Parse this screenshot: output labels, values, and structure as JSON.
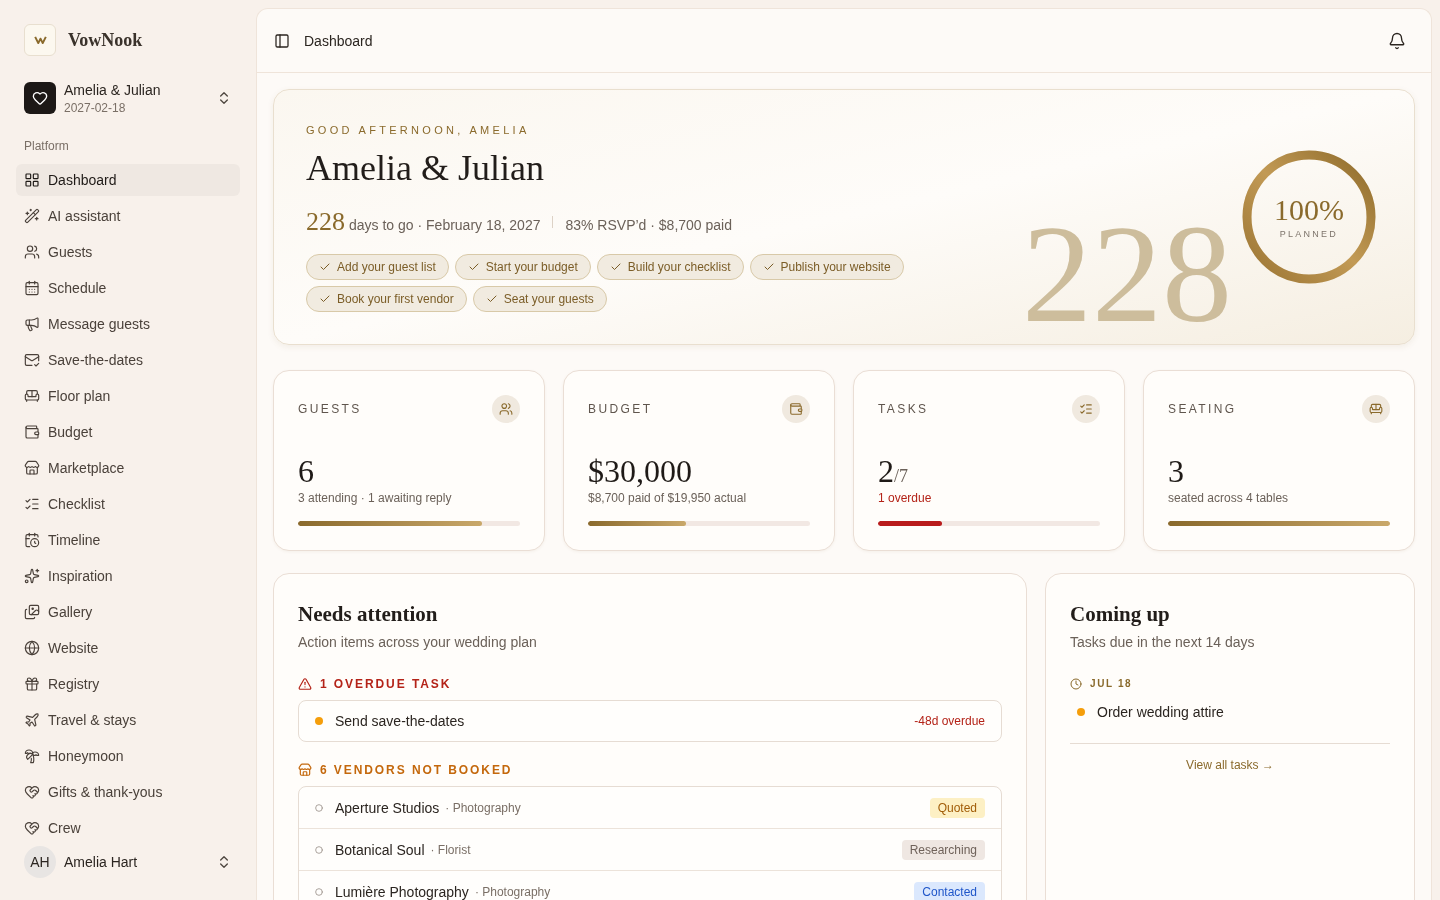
{
  "sidebar": {
    "brand": {
      "name": "VowNook"
    },
    "workspace": {
      "name": "Amelia & Julian",
      "date": "2027-02-18"
    },
    "section_label": "Platform",
    "items": [
      {
        "label": "Dashboard",
        "selected": true
      },
      {
        "label": "AI assistant",
        "selected": false
      },
      {
        "label": "Guests",
        "selected": false
      },
      {
        "label": "Schedule",
        "selected": false
      },
      {
        "label": "Message guests",
        "selected": false
      },
      {
        "label": "Save-the-dates",
        "selected": false
      },
      {
        "label": "Floor plan",
        "selected": false
      },
      {
        "label": "Budget",
        "selected": false
      },
      {
        "label": "Marketplace",
        "selected": false
      },
      {
        "label": "Checklist",
        "selected": false
      },
      {
        "label": "Timeline",
        "selected": false
      },
      {
        "label": "Inspiration",
        "selected": false
      },
      {
        "label": "Gallery",
        "selected": false
      },
      {
        "label": "Website",
        "selected": false
      },
      {
        "label": "Registry",
        "selected": false
      },
      {
        "label": "Travel & stays",
        "selected": false
      },
      {
        "label": "Honeymoon",
        "selected": false
      },
      {
        "label": "Gifts & thank-yous",
        "selected": false
      },
      {
        "label": "Crew",
        "selected": false
      }
    ],
    "user": {
      "initials": "AH",
      "name": "Amelia Hart"
    }
  },
  "header": {
    "title": "Dashboard"
  },
  "hero": {
    "greeting": "GOOD AFTERNOON, AMELIA",
    "title": "Amelia & Julian",
    "countdown": "228",
    "countdown_caption": "days to go · February 18, 2027",
    "summary": "83% RSVP’d · $8,700 paid",
    "chips": [
      {
        "label": "Add your guest list",
        "done": true
      },
      {
        "label": "Start your budget",
        "done": true
      },
      {
        "label": "Build your checklist",
        "done": true
      },
      {
        "label": "Publish your website",
        "done": true
      },
      {
        "label": "Book your first vendor",
        "done": true
      },
      {
        "label": "Seat your guests",
        "done": true
      }
    ],
    "progress": {
      "value": "100%",
      "caption": "PLANNED",
      "level": 1.0
    },
    "backdrop_number": "228"
  },
  "stats": [
    {
      "label": "GUESTS",
      "value": "6",
      "detail": "3 attending · 1 awaiting reply",
      "alert": false,
      "level": 0.83
    },
    {
      "label": "BUDGET",
      "value": "$30,000",
      "detail": "$8,700 paid of $19,950 actual",
      "alert": false,
      "level": 0.44
    },
    {
      "label": "TASKS",
      "value": "2",
      "value_suffix": "/7",
      "detail": "1 overdue",
      "alert": true,
      "level": 0.29
    },
    {
      "label": "SEATING",
      "value": "3",
      "detail": "seated across 4 tables",
      "alert": false,
      "level": 1.0
    }
  ],
  "needs_attention": {
    "title": "Needs attention",
    "subtitle": "Action items across your wedding plan",
    "overdue": {
      "heading": "1 OVERDUE TASK",
      "tasks": [
        {
          "title": "Send save-the-dates",
          "due": "-48d overdue",
          "color": "#f59e0b"
        }
      ]
    },
    "vendors": {
      "heading": "6 VENDORS NOT BOOKED",
      "rows": [
        {
          "name": "Aperture Studios",
          "category": "· Photography",
          "status": {
            "label": "Quoted",
            "kind": "quoted"
          }
        },
        {
          "name": "Botanical Soul",
          "category": "· Florist",
          "status": {
            "label": "Researching",
            "kind": "researching"
          }
        },
        {
          "name": "Lumière Photography",
          "category": "· Photography",
          "status": {
            "label": "Contacted",
            "kind": "contacted"
          }
        }
      ]
    }
  },
  "coming_up": {
    "title": "Coming up",
    "subtitle": "Tasks due in the next 14 days",
    "groups": [
      {
        "date": "JUL 18",
        "tasks": [
          {
            "title": "Order wedding attire",
            "color": "#f59e0b"
          }
        ]
      }
    ],
    "link": "View all tasks →"
  }
}
